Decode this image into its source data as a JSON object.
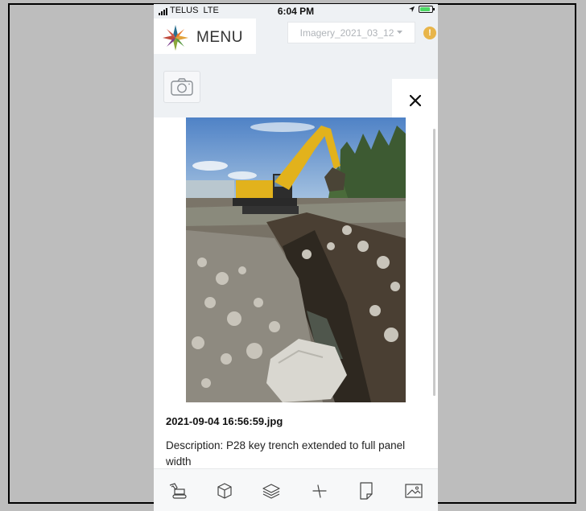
{
  "status_bar": {
    "carrier": "TELUS",
    "network": "LTE",
    "time": "6:04 PM"
  },
  "header": {
    "menu_label": "MENU",
    "imagery_select": "Imagery_2021_03_12",
    "alert_badge": "!"
  },
  "photo_view": {
    "filename": "2021-09-04 16:56:59.jpg",
    "description": "Description: P28 key trench extended to full panel width"
  },
  "toolbar": {
    "items": [
      "excavator-icon",
      "cube-icon",
      "layers-icon",
      "measure-icon",
      "note-icon",
      "image-icon"
    ]
  },
  "colors": {
    "page_bg": "#bdbdbd",
    "app_bg": "#eef1f4",
    "alert": "#e8b54a",
    "battery": "#4cd964"
  }
}
